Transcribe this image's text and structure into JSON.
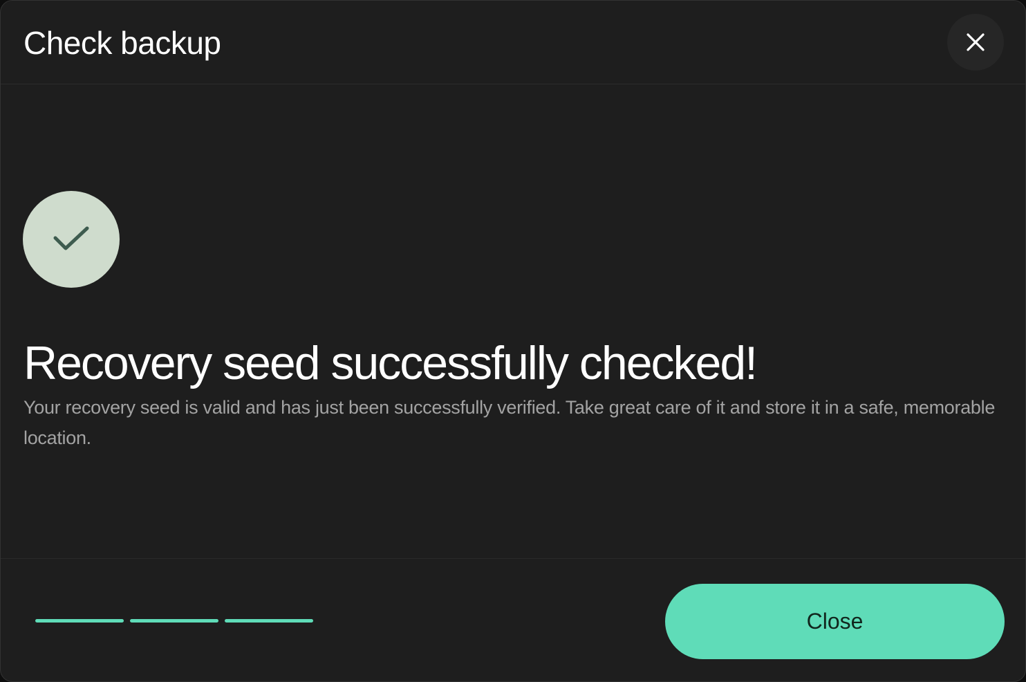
{
  "header": {
    "title": "Check backup",
    "close_icon": "close-icon"
  },
  "status": {
    "icon": "checkmark-icon",
    "badge_color": "#cfdccd",
    "icon_color": "#3e5c4f"
  },
  "content": {
    "heading": "Recovery seed successfully checked!",
    "description": "Your recovery seed is valid and has just been successfully verified. Take great care of it and store it in a safe, memorable location."
  },
  "progress": {
    "steps_total": 3,
    "steps_completed": 3,
    "color": "#5fdcb8"
  },
  "footer": {
    "close_label": "Close",
    "accent": "#5fdcb8"
  }
}
